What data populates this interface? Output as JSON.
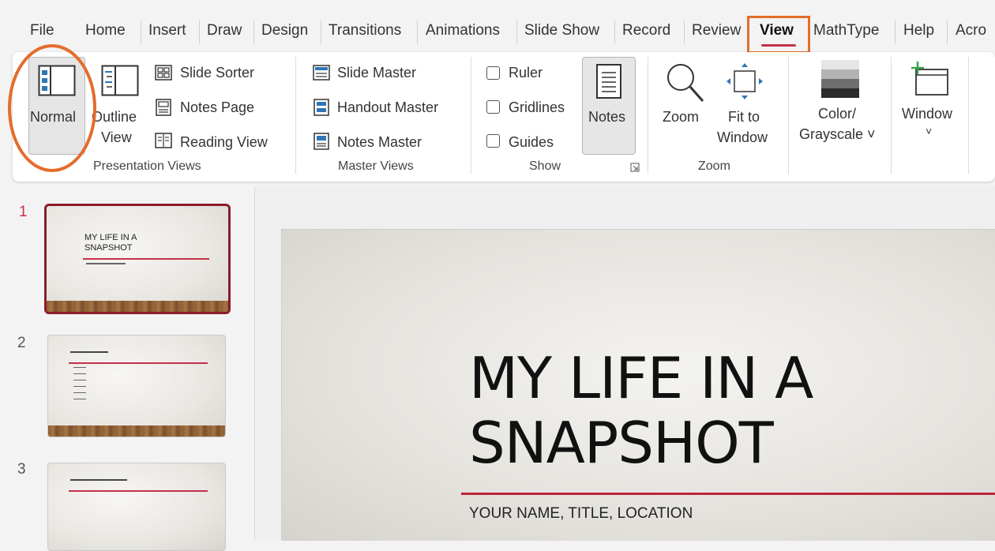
{
  "tabs": [
    "File",
    "Home",
    "Insert",
    "Draw",
    "Design",
    "Transitions",
    "Animations",
    "Slide Show",
    "Record",
    "Review",
    "View",
    "MathType",
    "Help",
    "Acro"
  ],
  "active_tab": "View",
  "ribbon": {
    "presentation_views": {
      "normal": "Normal",
      "outline_view_1": "Outline",
      "outline_view_2": "View",
      "slide_sorter": "Slide Sorter",
      "notes_page": "Notes Page",
      "reading_view": "Reading View",
      "group_label": "Presentation Views"
    },
    "master_views": {
      "slide_master": "Slide Master",
      "handout_master": "Handout Master",
      "notes_master": "Notes Master",
      "group_label": "Master Views"
    },
    "show": {
      "ruler": "Ruler",
      "gridlines": "Gridlines",
      "guides": "Guides",
      "notes": "Notes",
      "group_label": "Show"
    },
    "zoom": {
      "zoom": "Zoom",
      "fit_1": "Fit to",
      "fit_2": "Window",
      "group_label": "Zoom"
    },
    "color": {
      "line1": "Color/",
      "line2": "Grayscale ˅"
    },
    "window": {
      "label": "Window",
      "caret": "˅"
    }
  },
  "thumbnails": [
    {
      "num": "1",
      "title_1": "MY LIFE IN A",
      "title_2": "SNAPSHOT"
    },
    {
      "num": "2"
    },
    {
      "num": "3"
    }
  ],
  "slide": {
    "title_1": "MY LIFE IN A",
    "title_2": "SNAPSHOT",
    "subtitle": "YOUR NAME, TITLE, LOCATION"
  },
  "colors": {
    "accent": "#c4314b",
    "highlight": "#e46c2b"
  }
}
